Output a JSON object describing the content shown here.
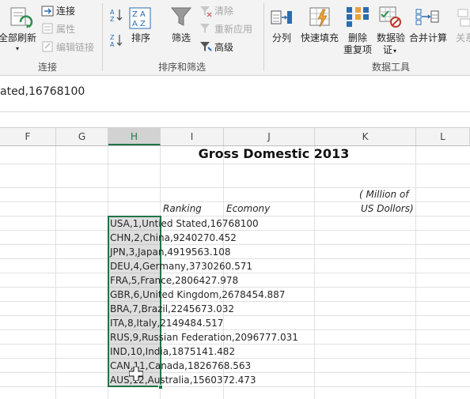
{
  "ribbon": {
    "groups": {
      "connections": {
        "refresh_all_label": "全部刷新",
        "connections_label": "连接",
        "properties_label": "属性",
        "edit_links_label": "编辑链接",
        "group_label": "连接"
      },
      "sort_filter": {
        "sort_label": "排序",
        "filter_label": "筛选",
        "clear_label": "清除",
        "reapply_label": "重新应用",
        "advanced_label": "高级",
        "group_label": "排序和筛选"
      },
      "data_tools": {
        "text_to_columns_label": "分列",
        "flash_fill_label": "快速填充",
        "remove_duplicates_label_line1": "删除",
        "remove_duplicates_label_line2": "重复项",
        "data_validation_label": "数据验",
        "data_validation_label_line2": "证",
        "consolidate_label": "合并计算",
        "relationships_label": "关系",
        "group_label": "数据工具"
      }
    },
    "colors": {
      "accent": "#217346",
      "icon_blue": "#2b6cb0"
    }
  },
  "formula_bar": {
    "content": "ated,16768100"
  },
  "grid": {
    "columns": [
      "F",
      "G",
      "H",
      "I",
      "J",
      "K",
      "L"
    ],
    "selected_column": "H",
    "title": "Gross Domestic 2013",
    "header_note_line1": "( Million of",
    "header_note_line2": "US Dollors)",
    "ranking_label": "Ranking",
    "economy_label": "Ecomony",
    "rows": [
      "USA,1,Untied Stated,16768100",
      "CHN,2,China,9240270.452",
      "JPN,3,Japan,4919563.108",
      "DEU,4,Germany,3730260.571",
      "FRA,5,France,2806427.978",
      "GBR,6,United Kingdom,2678454.887",
      "BRA,7,Brazil,2245673.032",
      "ITA,8,Italy,2149484.517",
      "RUS,9,Russian Federation,2096777.031",
      "IND,10,India,1875141.482",
      "CAN,11,Canada,1826768.563",
      "AUS,12,Australia,1560372.473"
    ]
  }
}
